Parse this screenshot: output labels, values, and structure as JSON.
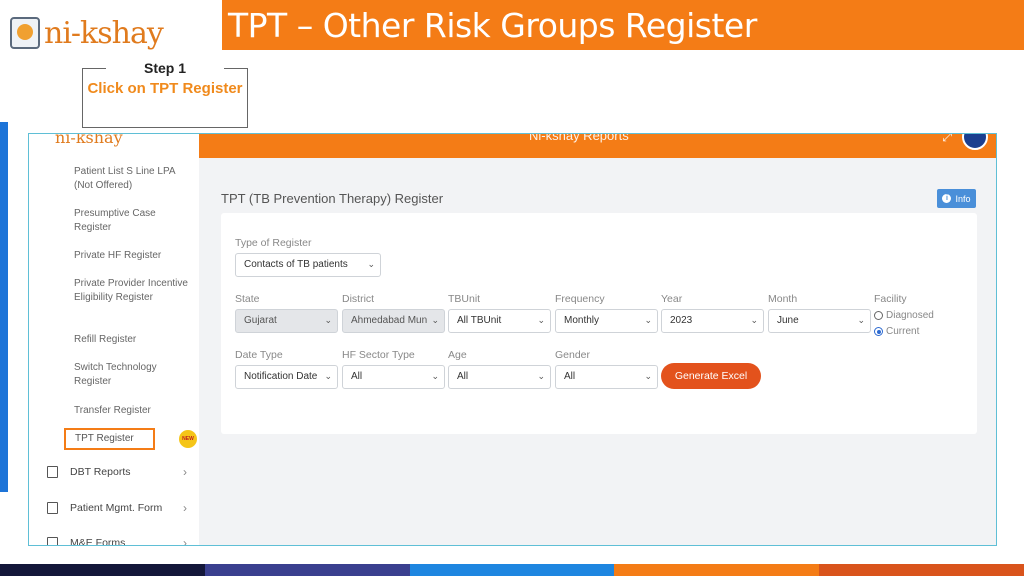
{
  "slide": {
    "logo_text": "ni-kshay",
    "title": "TPT – Other Risk Groups Register",
    "step_label": "Step 1",
    "step_instruction": "Click on TPT Register"
  },
  "app": {
    "topbar_title": "Ni-kshay Reports",
    "sidebar_items": [
      {
        "label": "Patient List S Line LPA (Not Offered)"
      },
      {
        "label": "Presumptive Case Register"
      },
      {
        "label": "Private HF Register"
      },
      {
        "label": "Private Provider Incentive Eligibility Register"
      },
      {
        "label": "Refill Register"
      },
      {
        "label": "Switch Technology Register"
      },
      {
        "label": "Transfer Register"
      },
      {
        "label": "TPT Register"
      }
    ],
    "new_badge": "NEW",
    "sidebar_sections": [
      {
        "label": "DBT Reports"
      },
      {
        "label": "Patient Mgmt. Form"
      },
      {
        "label": "M&E Forms"
      }
    ],
    "page_title": "TPT (TB Prevention Therapy) Register",
    "info_label": "Info",
    "form": {
      "type_label": "Type of Register",
      "type_value": "Contacts of TB patients",
      "state_label": "State",
      "state_value": "Gujarat",
      "district_label": "District",
      "district_value": "Ahmedabad Mun",
      "tbunit_label": "TBUnit",
      "tbunit_value": "All TBUnit",
      "frequency_label": "Frequency",
      "frequency_value": "Monthly",
      "year_label": "Year",
      "year_value": "2023",
      "month_label": "Month",
      "month_value": "June",
      "facility_label": "Facility",
      "facility_opt1": "Diagnosed",
      "facility_opt2": "Current",
      "datetype_label": "Date Type",
      "datetype_value": "Notification Date",
      "hfsector_label": "HF Sector Type",
      "hfsector_value": "All",
      "age_label": "Age",
      "age_value": "All",
      "gender_label": "Gender",
      "gender_value": "All",
      "generate_label": "Generate Excel"
    }
  },
  "colors": {
    "brand_orange": "#f47c16",
    "button_red": "#e3521c",
    "info_blue": "#4a8fd9",
    "bottom_bar": [
      "#14173a",
      "#3a3f8f",
      "#1e86e0",
      "#f47c16",
      "#d9541c"
    ]
  }
}
